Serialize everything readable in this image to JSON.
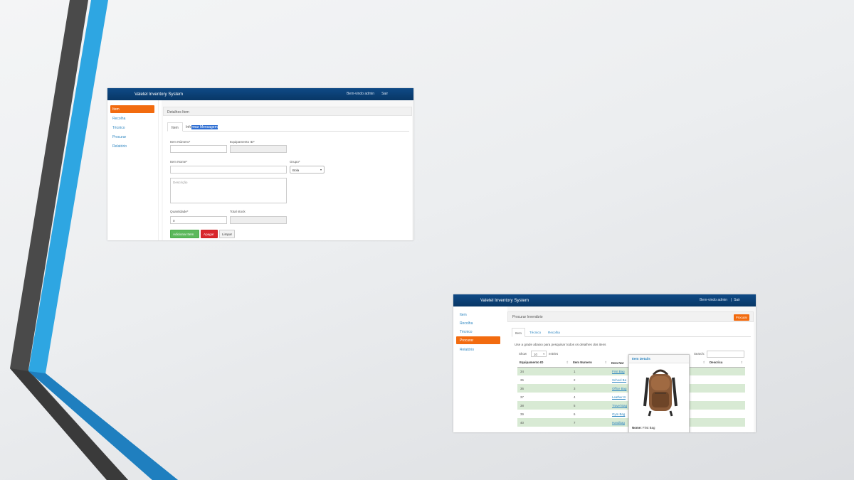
{
  "shot1": {
    "app_title": "Valetel Inventory System",
    "welcome": "Bem-vindo admin",
    "logout": "Sair",
    "sidebar": [
      {
        "label": "Item",
        "active": true
      },
      {
        "label": "Recolha",
        "active": false
      },
      {
        "label": "Técnico",
        "active": false
      },
      {
        "label": "Procurar",
        "active": false
      },
      {
        "label": "Relatório",
        "active": false
      }
    ],
    "panel_title": "Detalhes Item",
    "tabs": [
      {
        "label": "Item",
        "active": true
      },
      {
        "label_prefix": "Info",
        "label_selected": "rmar Mensagem",
        "active": false
      }
    ],
    "form": {
      "item_number_label": "Item Número*",
      "item_number_value": "",
      "equipment_id_label": "Equipamento ID*",
      "equipment_id_value": "",
      "item_name_label": "Item Nome*",
      "item_name_value": "",
      "group_label": "Grupo*",
      "group_value": "Bola",
      "description_placeholder": "Descrição",
      "quantity_label": "Quantidade*",
      "quantity_value": "0",
      "total_stock_label": "Total stock",
      "total_stock_value": ""
    },
    "buttons": {
      "add": "Adicionar Item",
      "delete": "Apagar",
      "clear": "Limpar"
    }
  },
  "shot2": {
    "app_title": "Valetel Inventory System",
    "welcome": "Bem-vindo admin",
    "separator": "|",
    "logout": "Sair",
    "sidebar": [
      {
        "label": "Item",
        "active": false
      },
      {
        "label": "Recolha",
        "active": false
      },
      {
        "label": "Técnico",
        "active": false
      },
      {
        "label": "Procurar",
        "active": true
      },
      {
        "label": "Relatório",
        "active": false
      }
    ],
    "panel_title": "Procurar Inventário",
    "search_button": "Procurar",
    "tabs": [
      {
        "label": "Item",
        "active": true
      },
      {
        "label": "Técnico",
        "active": false
      },
      {
        "label": "Recolha",
        "active": false
      }
    ],
    "hint": "Use a grade abaixo para pesquisar todos os detalhes dos itens",
    "show_label": "Show",
    "page_length": "10",
    "entries_label": "entries",
    "search_label": "Search:",
    "columns": [
      "Equipamento ID",
      "Item Numero",
      "Item Nor",
      "",
      "Descrica"
    ],
    "rows": [
      {
        "id": "34",
        "num": "1",
        "name": "First Bag"
      },
      {
        "id": "35",
        "num": "2",
        "name": "School Ba"
      },
      {
        "id": "36",
        "num": "3",
        "name": "Office Bag"
      },
      {
        "id": "37",
        "num": "4",
        "name": "Leather B"
      },
      {
        "id": "38",
        "num": "5",
        "name": "Travel Bag"
      },
      {
        "id": "39",
        "num": "6",
        "name": "Gym Bag"
      },
      {
        "id": "40",
        "num": "7",
        "name": "Handbag"
      }
    ],
    "popover": {
      "title": "Item Details",
      "name_key": "Nome:",
      "name_value": "First Bag"
    }
  }
}
